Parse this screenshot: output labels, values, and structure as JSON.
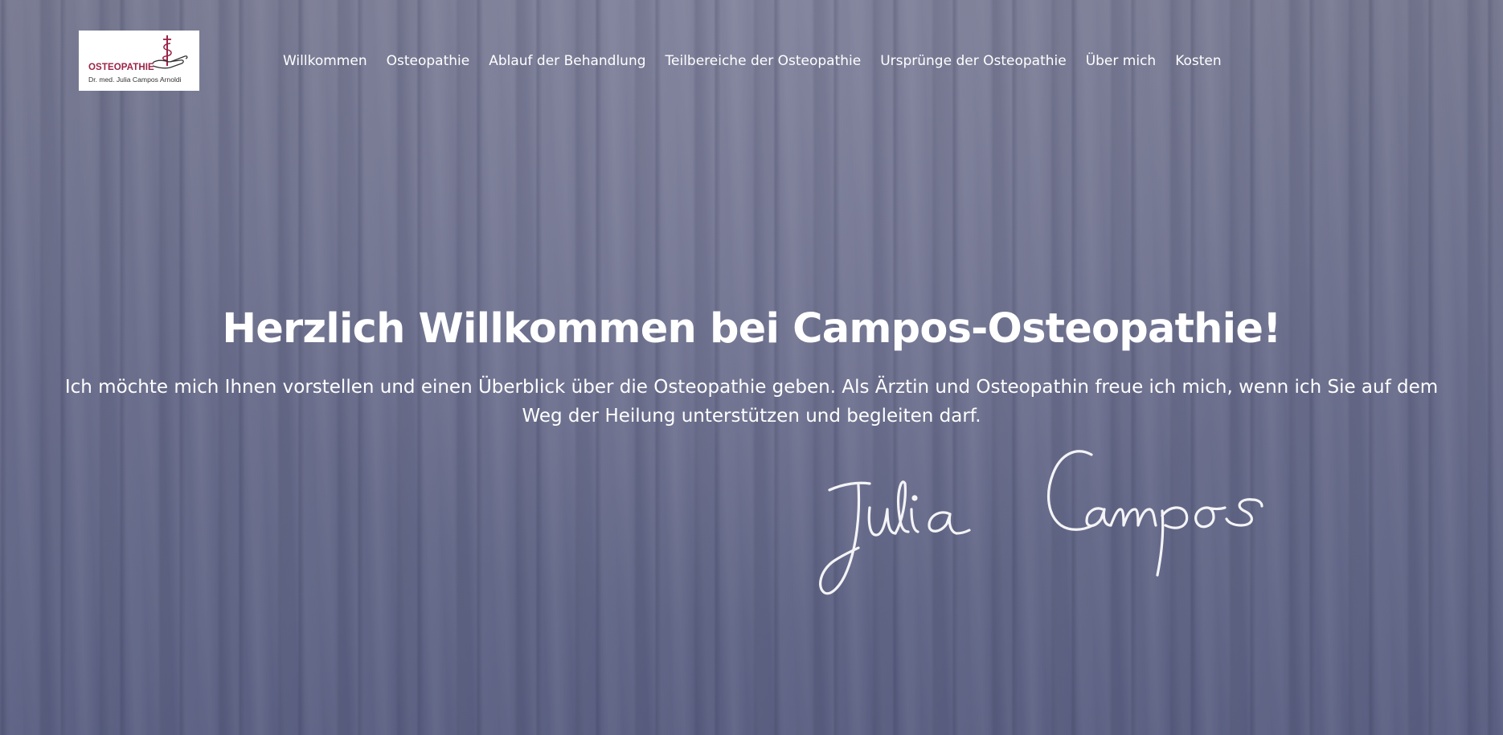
{
  "header": {
    "logo": {
      "word": "OSTEOPATHIE",
      "name": "Dr. med. Julia Campos Arnoldi",
      "brand_color": "#9b2347",
      "icon": "caduceus-hand-icon"
    },
    "nav": [
      {
        "label": "Willkommen"
      },
      {
        "label": "Osteopathie"
      },
      {
        "label": "Ablauf der Behandlung"
      },
      {
        "label": "Teilbereiche der Osteopathie"
      },
      {
        "label": "Ursprünge der Osteopathie"
      },
      {
        "label": "Über mich"
      },
      {
        "label": "Kosten"
      }
    ]
  },
  "hero": {
    "title": "Herzlich Willkommen bei Campos-Osteopathie!",
    "intro": "Ich möchte mich Ihnen vorstellen und einen Überblick über die Osteopathie geben. Als Ärztin und Osteopathin freue ich mich, wenn ich Sie auf dem Weg der Heilung unterstützen und begleiten darf.",
    "signature": "Julia Campos",
    "background": "wood-planks-image"
  },
  "colors": {
    "text": "#ffffff",
    "background_tint": "#6f7388"
  }
}
